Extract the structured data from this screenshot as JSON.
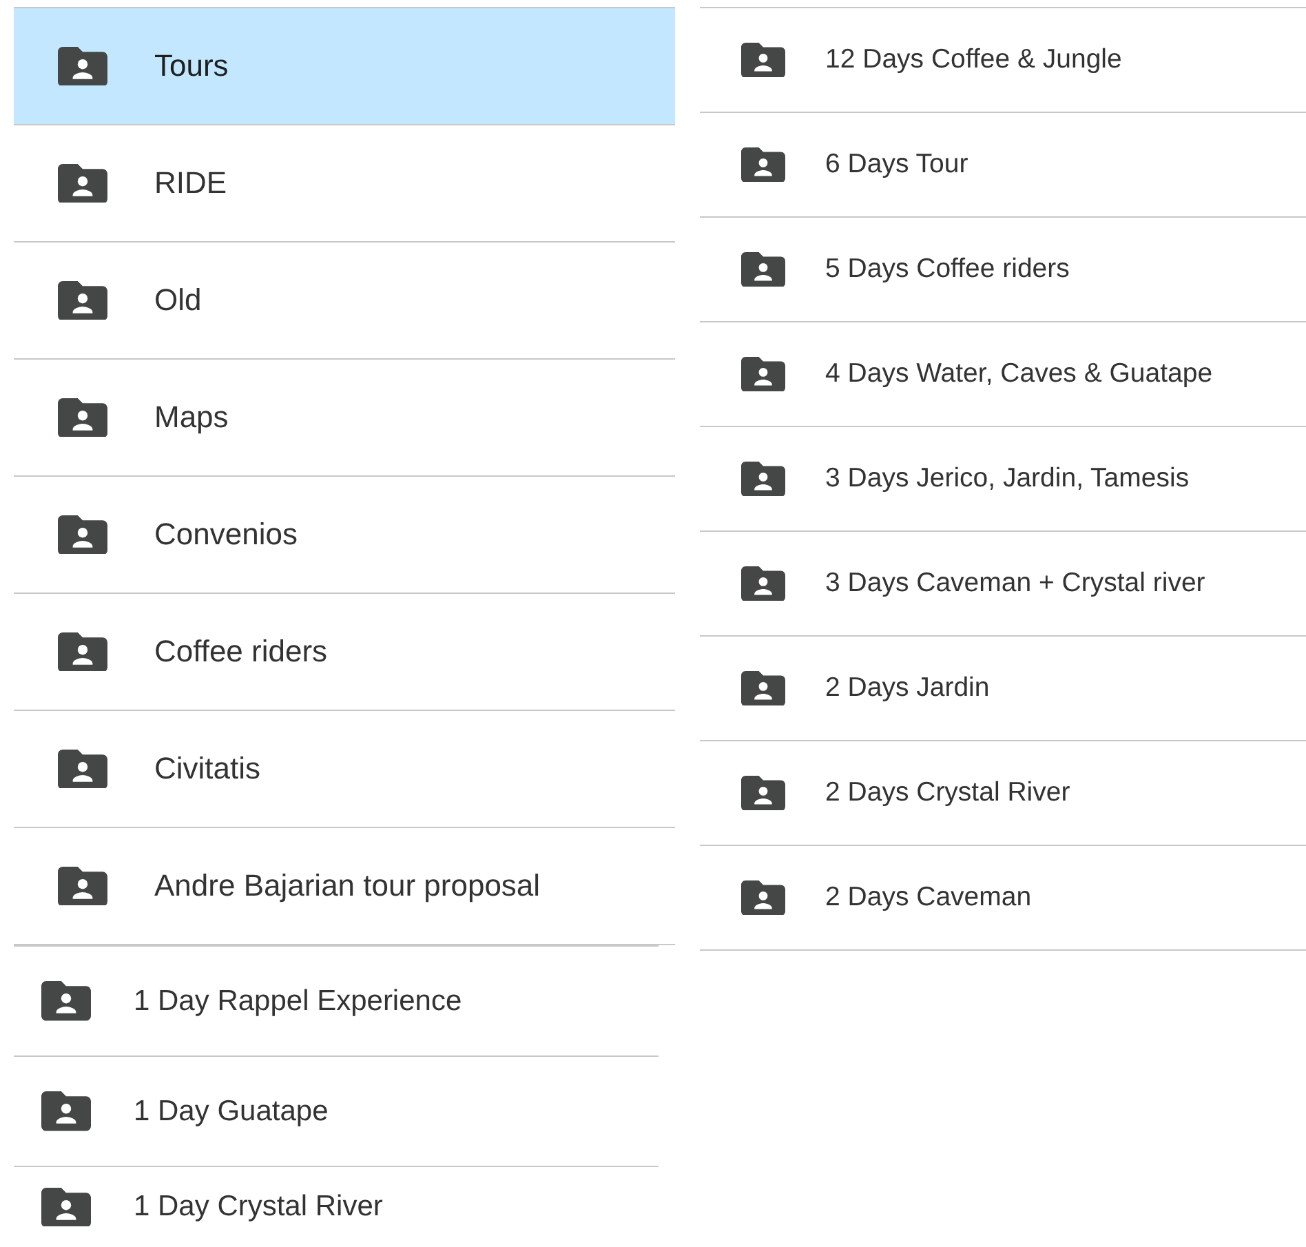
{
  "panels": [
    {
      "folders": [
        {
          "name": "Tours",
          "selected": true
        },
        {
          "name": "RIDE",
          "selected": false
        },
        {
          "name": "Old",
          "selected": false
        },
        {
          "name": "Maps",
          "selected": false
        },
        {
          "name": "Convenios",
          "selected": false
        },
        {
          "name": "Coffee riders",
          "selected": false
        },
        {
          "name": "Civitatis",
          "selected": false
        },
        {
          "name": "Andre Bajarian tour proposal",
          "selected": false
        }
      ]
    },
    {
      "folders": [
        {
          "name": "1 Day Rappel Experience",
          "selected": false
        },
        {
          "name": "1 Day Guatape",
          "selected": false
        },
        {
          "name": "1 Day Crystal River",
          "selected": false
        }
      ]
    },
    {
      "folders": [
        {
          "name": "12 Days Coffee & Jungle",
          "selected": false
        },
        {
          "name": "6 Days Tour",
          "selected": false
        },
        {
          "name": "5 Days Coffee riders",
          "selected": false
        },
        {
          "name": "4 Days Water, Caves & Guatape",
          "selected": false
        },
        {
          "name": "3 Days Jerico, Jardin, Tamesis",
          "selected": false
        },
        {
          "name": "3 Days Caveman + Crystal river",
          "selected": false
        },
        {
          "name": "2 Days Jardin",
          "selected": false
        },
        {
          "name": "2 Days Crystal River",
          "selected": false
        },
        {
          "name": "2 Days Caveman",
          "selected": false
        }
      ]
    }
  ]
}
